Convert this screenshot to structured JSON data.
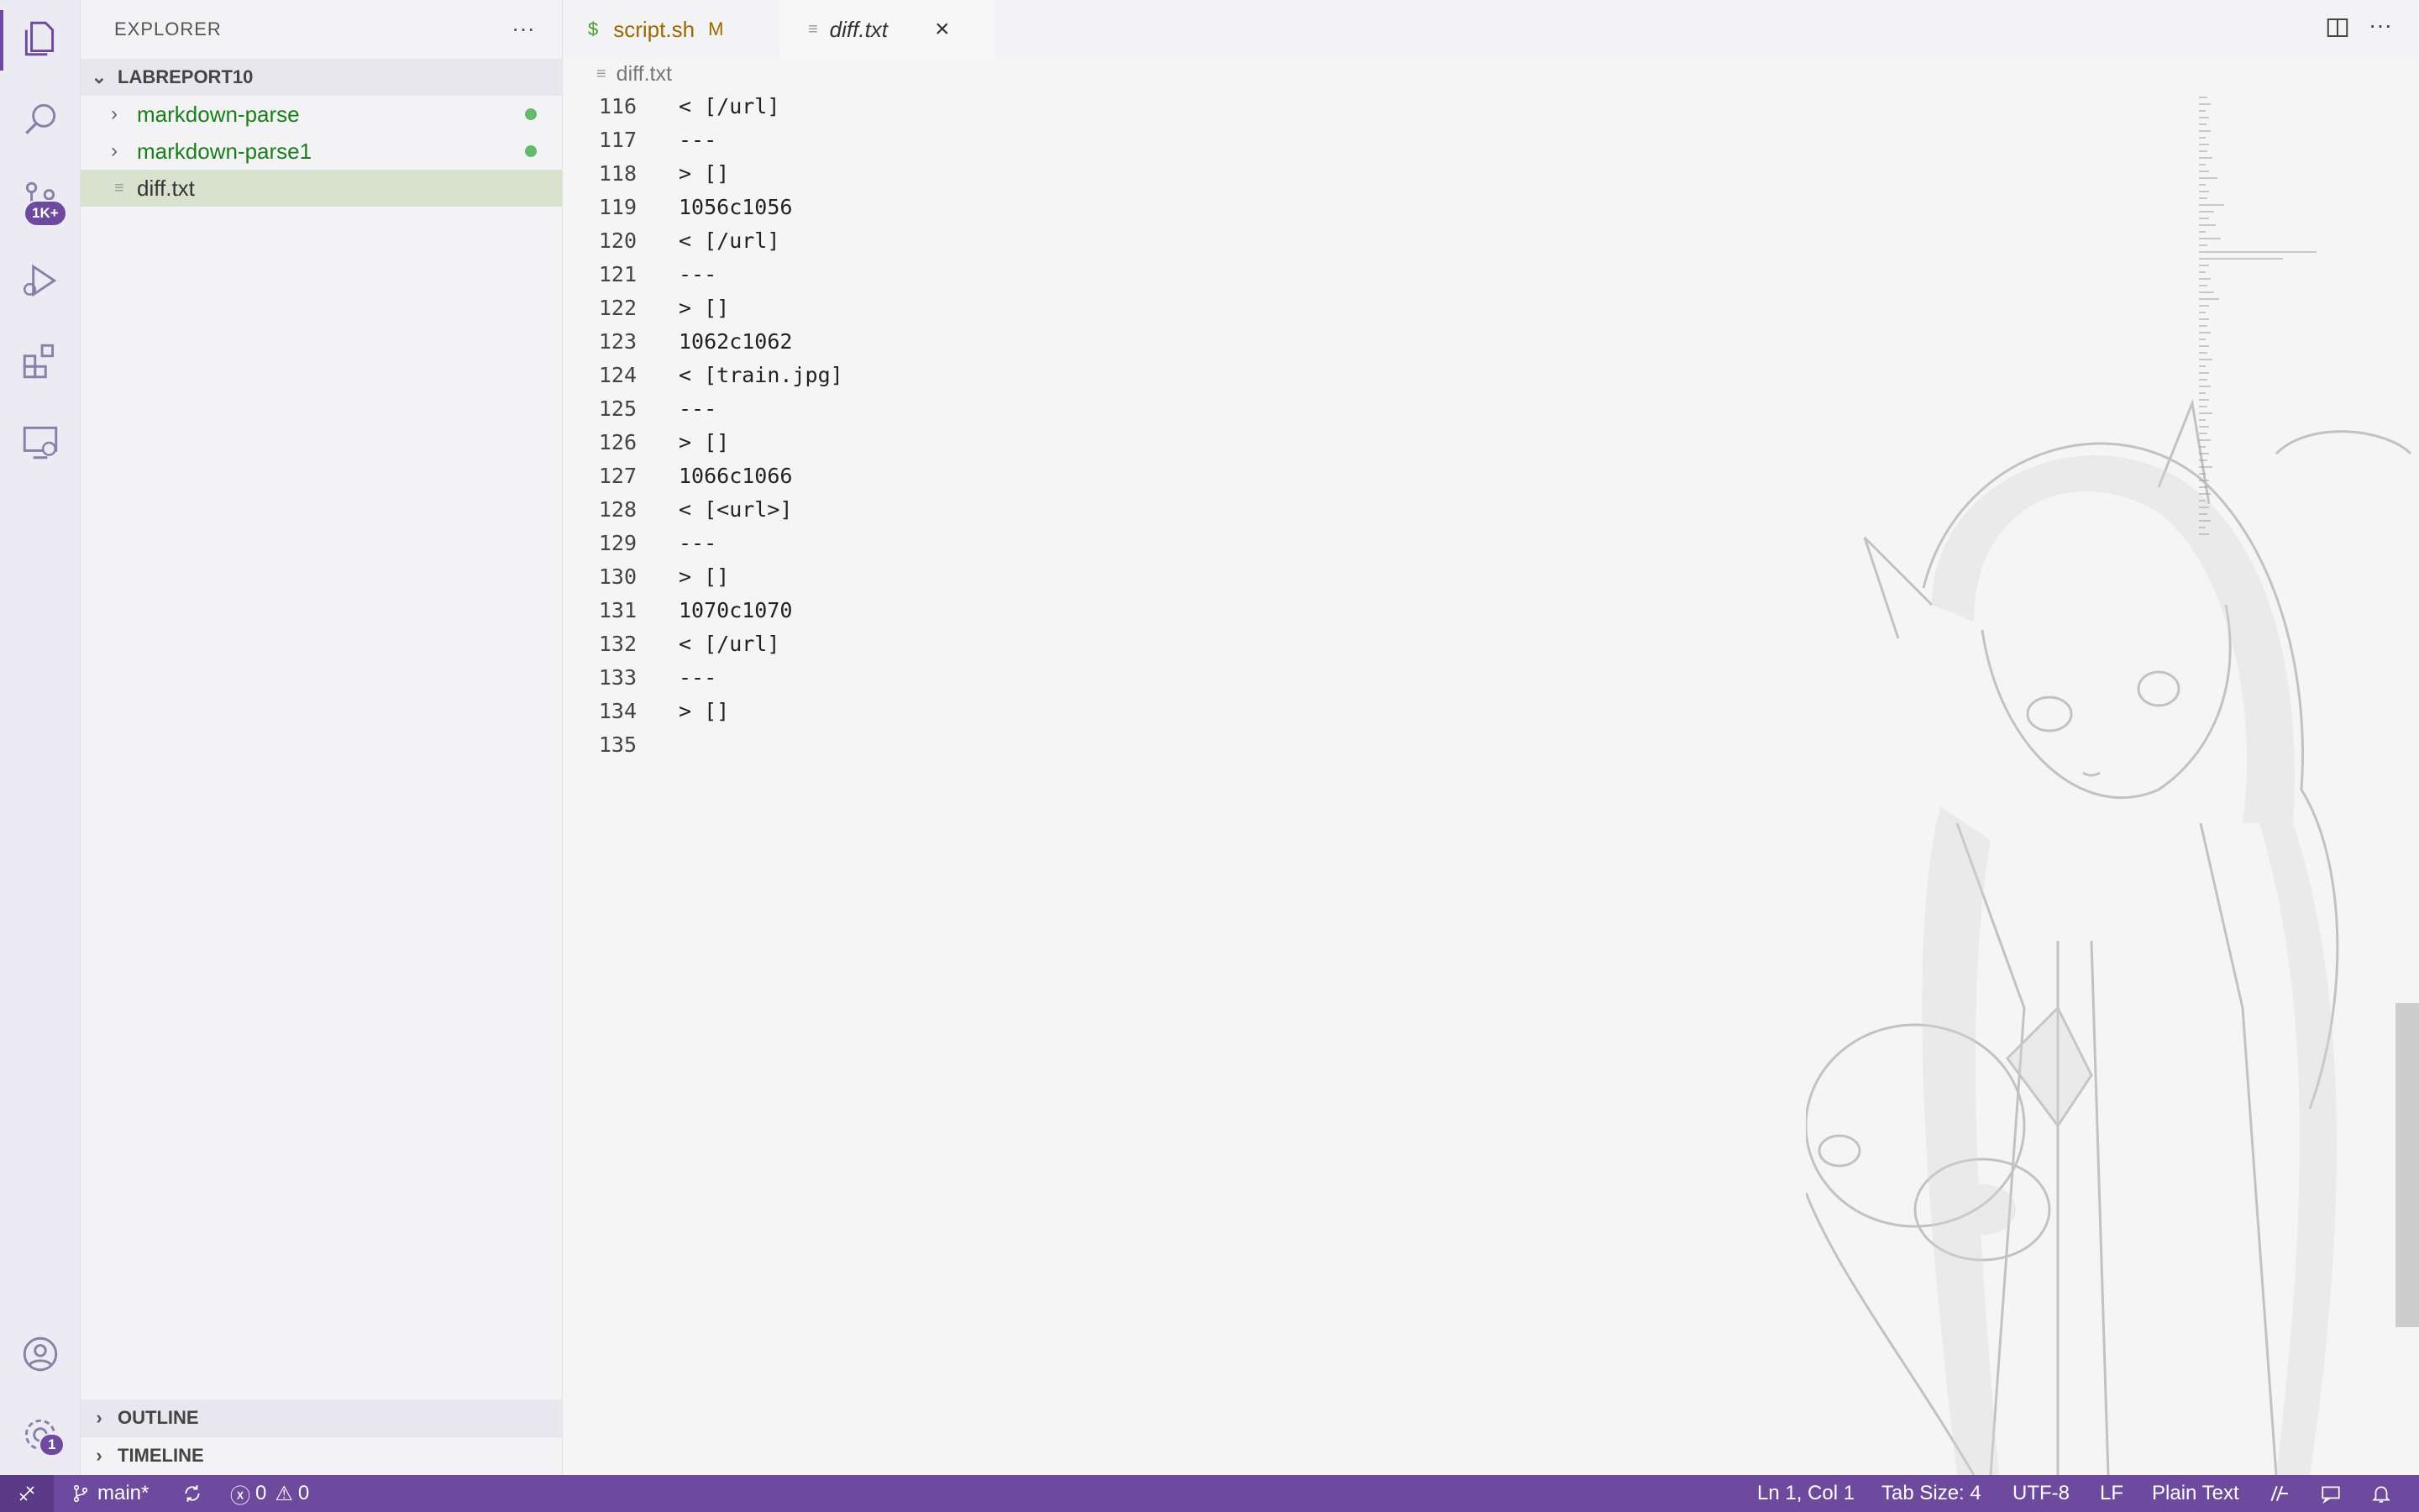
{
  "colors": {
    "accent": "#6e4a9e",
    "modified_green": "#1a7f1a",
    "status_bar": "#6e4a9e"
  },
  "activity_bar": {
    "icons": [
      "files-icon",
      "search-icon",
      "source-control-icon",
      "run-debug-icon",
      "extensions-icon",
      "remote-explorer-icon",
      "account-icon",
      "settings-gear-icon"
    ],
    "source_control_badge": "1K+",
    "settings_badge": "1"
  },
  "sidebar": {
    "title": "EXPLORER",
    "folder": "LABREPORT10",
    "items": [
      {
        "label": "markdown-parse",
        "type": "folder"
      },
      {
        "label": "markdown-parse1",
        "type": "folder"
      },
      {
        "label": "diff.txt",
        "type": "file"
      }
    ],
    "outline": "OUTLINE",
    "timeline": "TIMELINE"
  },
  "tabs": [
    {
      "icon": "$",
      "label": "script.sh",
      "status": "M"
    },
    {
      "label": "diff.txt",
      "close": "×"
    }
  ],
  "breadcrumb": "diff.txt",
  "editor": {
    "lines": [
      {
        "n": "116",
        "text": "< [/url]"
      },
      {
        "n": "117",
        "text": "---"
      },
      {
        "n": "118",
        "text": "> []"
      },
      {
        "n": "119",
        "text": "1056c1056"
      },
      {
        "n": "120",
        "text": "< [/url]"
      },
      {
        "n": "121",
        "text": "---"
      },
      {
        "n": "122",
        "text": "> []"
      },
      {
        "n": "123",
        "text": "1062c1062"
      },
      {
        "n": "124",
        "text": "< [train.jpg]"
      },
      {
        "n": "125",
        "text": "---"
      },
      {
        "n": "126",
        "text": "> []"
      },
      {
        "n": "127",
        "text": "1066c1066"
      },
      {
        "n": "128",
        "text": "< [<url>]"
      },
      {
        "n": "129",
        "text": "---"
      },
      {
        "n": "130",
        "text": "> []"
      },
      {
        "n": "131",
        "text": "1070c1070"
      },
      {
        "n": "132",
        "text": "< [/url]"
      },
      {
        "n": "133",
        "text": "---"
      },
      {
        "n": "134",
        "text": "> []"
      },
      {
        "n": "135",
        "text": ""
      }
    ]
  },
  "statusbar": {
    "branch": "main*",
    "errors": "0",
    "warnings": "0",
    "position": "Ln 1, Col 1",
    "tab_size": "Tab Size: 4",
    "encoding": "UTF-8",
    "eol": "LF",
    "language": "Plain Text"
  }
}
